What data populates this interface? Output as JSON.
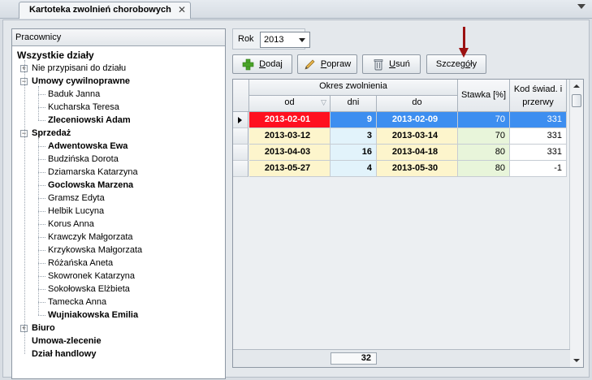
{
  "tab": {
    "title": "Kartoteka zwolnień chorobowych",
    "close": "✕"
  },
  "employees": {
    "header": "Pracownicy",
    "tree": [
      {
        "label": "Wszystkie działy",
        "level": 0,
        "bold": true,
        "root": true
      },
      {
        "label": "Nie przypisani do działu",
        "level": 1,
        "bold": false,
        "expander": "+"
      },
      {
        "label": "Umowy cywilnoprawne",
        "level": 1,
        "bold": true,
        "expander": "−"
      },
      {
        "label": "Baduk Janna",
        "level": 2,
        "bold": false
      },
      {
        "label": "Kucharska Teresa",
        "level": 2,
        "bold": false
      },
      {
        "label": "Zleceniowski Adam",
        "level": 2,
        "bold": true
      },
      {
        "label": "Sprzedaż",
        "level": 1,
        "bold": true,
        "expander": "−"
      },
      {
        "label": "Adwentowska Ewa",
        "level": 2,
        "bold": true,
        "selected": true
      },
      {
        "label": "Budzińska Dorota",
        "level": 2,
        "bold": false
      },
      {
        "label": "Dziamarska Katarzyna",
        "level": 2,
        "bold": false
      },
      {
        "label": "Goclowska Marzena",
        "level": 2,
        "bold": true
      },
      {
        "label": "Gramsz Edyta",
        "level": 2,
        "bold": false
      },
      {
        "label": "Helbik Lucyna",
        "level": 2,
        "bold": false
      },
      {
        "label": "Korus Anna",
        "level": 2,
        "bold": false
      },
      {
        "label": "Krawczyk Małgorzata",
        "level": 2,
        "bold": false
      },
      {
        "label": "Krzykowska Małgorzata",
        "level": 2,
        "bold": false
      },
      {
        "label": "Różańska Aneta",
        "level": 2,
        "bold": false
      },
      {
        "label": "Skowronek Katarzyna",
        "level": 2,
        "bold": false
      },
      {
        "label": "Sokołowska Elżbieta",
        "level": 2,
        "bold": false
      },
      {
        "label": "Tamecka Anna",
        "level": 2,
        "bold": false
      },
      {
        "label": "Wujniakowska Emilia",
        "level": 2,
        "bold": true
      },
      {
        "label": "Biuro",
        "level": 1,
        "bold": true,
        "expander": "+"
      },
      {
        "label": "Umowa-zlecenie",
        "level": 1,
        "bold": true
      },
      {
        "label": "Dział handlowy",
        "level": 1,
        "bold": true
      }
    ]
  },
  "year": {
    "label": "Rok",
    "value": "2013"
  },
  "toolbar": {
    "add": {
      "accel": "D",
      "rest": "odaj"
    },
    "edit": {
      "accel": "P",
      "rest": "opraw"
    },
    "delete": {
      "accel": "U",
      "rest": "suń"
    },
    "details": {
      "pre": "Szczeg",
      "accel": "ó",
      "rest": "ły"
    }
  },
  "grid": {
    "group_header": "Okres zwolnienia",
    "columns": {
      "from": "od",
      "days": "dni",
      "to": "do",
      "rate": "Stawka [%]",
      "code": "Kod świad. i przerwy"
    },
    "rows": [
      {
        "from": "2013-02-01",
        "days": "9",
        "to": "2013-02-09",
        "rate": "70",
        "code": "331",
        "current": true
      },
      {
        "from": "2013-03-12",
        "days": "3",
        "to": "2013-03-14",
        "rate": "70",
        "code": "331"
      },
      {
        "from": "2013-04-03",
        "days": "16",
        "to": "2013-04-18",
        "rate": "80",
        "code": "331"
      },
      {
        "from": "2013-05-27",
        "days": "4",
        "to": "2013-05-30",
        "rate": "80",
        "code": "-1"
      }
    ],
    "total_days": "32"
  },
  "colors": {
    "selected_blue": "#3d8ef0",
    "error_red": "#ff1020",
    "date_bg": "#fdf5cc",
    "days_bg": "#e2f3fb",
    "rate_bg": "#e8f5da",
    "arrow": "#9b1111"
  }
}
